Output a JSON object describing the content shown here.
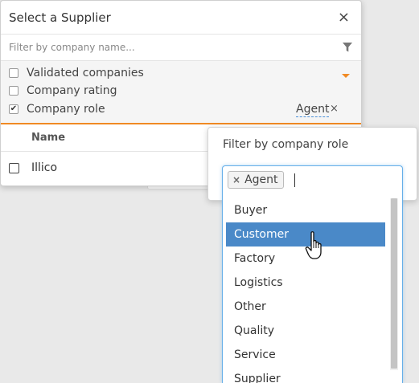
{
  "dialog": {
    "title": "Select a Supplier",
    "close_glyph": "×",
    "filter_placeholder": "Filter by company name...",
    "filters": [
      {
        "label": "Validated companies",
        "checked": false
      },
      {
        "label": "Company rating",
        "checked": false
      },
      {
        "label": "Company role",
        "checked": true
      }
    ],
    "role_value": "Agent",
    "role_remove_glyph": "×",
    "table": {
      "header": "Name",
      "rows": [
        {
          "name": "Illico",
          "checked": false
        }
      ]
    }
  },
  "role_popover": {
    "title": "Filter by company role",
    "selected_tag": "Agent",
    "tag_remove_glyph": "×",
    "options": [
      "Buyer",
      "Customer",
      "Factory",
      "Logistics",
      "Other",
      "Quality",
      "Service",
      "Supplier"
    ],
    "highlighted_option": "Customer"
  },
  "icons": {
    "close": "close-icon",
    "filter": "funnel-icon",
    "dropdown": "caret-down-icon",
    "cursor": "hand-pointer-icon"
  },
  "colors": {
    "accent_orange": "#f08a24",
    "highlight_blue": "#4a89c8",
    "focus_blue": "#66afe9"
  }
}
